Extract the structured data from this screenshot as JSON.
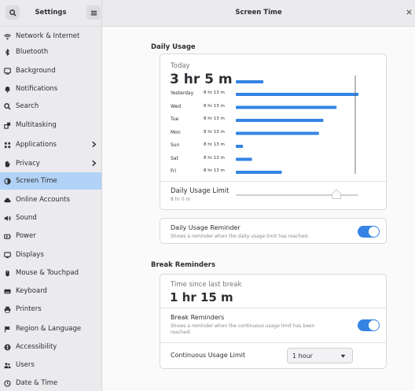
{
  "sidebar": {
    "title": "Settings",
    "search_icon": "search-icon",
    "menu_icon": "hamburger-menu-icon",
    "items": [
      {
        "label": "Network & Internet",
        "icon": "wifi-icon"
      },
      {
        "label": "Bluetooth",
        "icon": "bluetooth-icon"
      },
      {
        "label": "Background",
        "icon": "background-icon"
      },
      {
        "label": "Notifications",
        "icon": "bell-icon"
      },
      {
        "label": "Search",
        "icon": "search-icon"
      },
      {
        "label": "Multitasking",
        "icon": "multitasking-icon"
      },
      {
        "label": "Applications",
        "icon": "grid-icon",
        "chevron": true
      },
      {
        "label": "Privacy",
        "icon": "hand-icon",
        "chevron": true
      },
      {
        "label": "Screen Time",
        "icon": "screen-time-icon",
        "active": true
      },
      {
        "label": "Online Accounts",
        "icon": "cloud-icon"
      },
      {
        "label": "Sound",
        "icon": "speaker-icon"
      },
      {
        "label": "Power",
        "icon": "power-icon"
      },
      {
        "label": "Displays",
        "icon": "display-icon"
      },
      {
        "label": "Mouse & Touchpad",
        "icon": "mouse-icon"
      },
      {
        "label": "Keyboard",
        "icon": "keyboard-icon"
      },
      {
        "label": "Printers",
        "icon": "printer-icon"
      },
      {
        "label": "Region & Language",
        "icon": "flag-icon"
      },
      {
        "label": "Accessibility",
        "icon": "accessibility-icon"
      },
      {
        "label": "Users",
        "icon": "users-icon"
      },
      {
        "label": "Date & Time",
        "icon": "clock-icon"
      }
    ]
  },
  "main": {
    "title": "Screen Time",
    "close_icon": "close-icon",
    "daily_usage": {
      "section_title": "Daily Usage",
      "today_label": "Today",
      "today_value": "3 hr 5 m",
      "limit_label": "Daily Usage Limit",
      "limit_value": "8 hr 0 m",
      "limit_slider_fraction": 0.82
    },
    "reminder": {
      "title": "Daily Usage Reminder",
      "subtitle": "Shows a reminder when the daily usage limit has reached.",
      "enabled": true
    },
    "break_reminders": {
      "section_title": "Break Reminders",
      "since_label": "Time since last break",
      "since_value": "1 hr 15 m",
      "reminder_title": "Break Reminders",
      "reminder_subtitle": "Shows a reminder when the continuous usage limit has been reached.",
      "enabled": true,
      "continuous_label": "Continuous Usage Limit",
      "continuous_value": "1 hour"
    }
  },
  "colors": {
    "accent": "#3584e4",
    "active_row": "#b2d3f7",
    "limit_line": "#555555"
  },
  "chart_data": {
    "type": "bar",
    "orientation": "horizontal",
    "unit": "minutes",
    "max_scale_minutes": 480,
    "limit_minutes": 480,
    "today": {
      "label": "Today",
      "minutes": 185
    },
    "categories": [
      "Yesterday",
      "Wed",
      "Tue",
      "Mon",
      "Sun",
      "Sat",
      "Fri"
    ],
    "time_labels": [
      "8 hr 13 m",
      "8 hr 13 m",
      "8 hr 13 m",
      "8 hr 13 m",
      "8 hr 13 m",
      "8 hr 13 m",
      "8 hr 13 m"
    ],
    "values": [
      493,
      405,
      352,
      334,
      29,
      65,
      185
    ]
  }
}
